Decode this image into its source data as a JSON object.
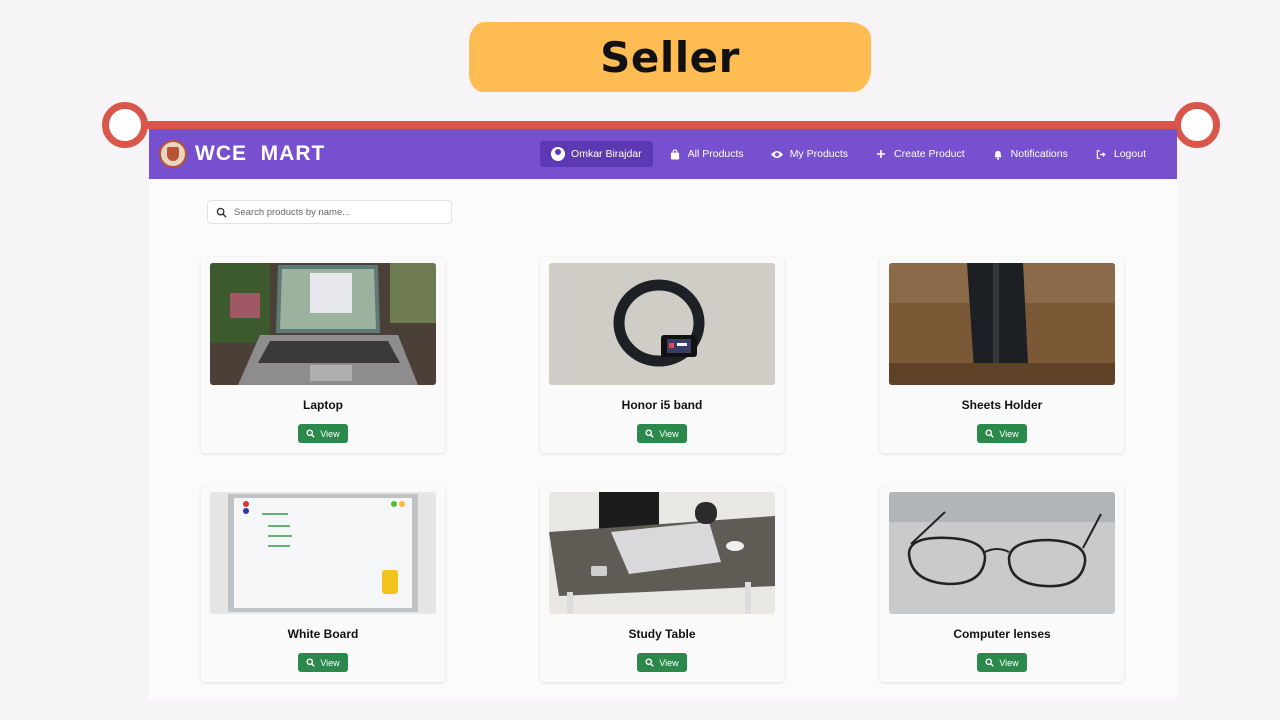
{
  "banner": {
    "text": "Seller"
  },
  "navbar": {
    "brand": "WCE  MART",
    "items": [
      {
        "label": "Omkar Birajdar",
        "icon": "user-circle-icon"
      },
      {
        "label": "All Products",
        "icon": "shopping-bag-icon"
      },
      {
        "label": "My Products",
        "icon": "eye-icon"
      },
      {
        "label": "Create Product",
        "icon": "plus-icon"
      },
      {
        "label": "Notifications",
        "icon": "bell-icon"
      },
      {
        "label": "Logout",
        "icon": "logout-icon"
      }
    ]
  },
  "search": {
    "placeholder": "Search products by name..."
  },
  "products": [
    {
      "name": "Laptop",
      "button": "View",
      "image": "laptop-photo"
    },
    {
      "name": "Honor i5 band",
      "button": "View",
      "image": "fitness-band-photo"
    },
    {
      "name": "Sheets Holder",
      "button": "View",
      "image": "sheets-holder-photo"
    },
    {
      "name": "White Board",
      "button": "View",
      "image": "whiteboard-photo"
    },
    {
      "name": "Study Table",
      "button": "View",
      "image": "study-table-photo"
    },
    {
      "name": "Computer lenses",
      "button": "View",
      "image": "glasses-photo"
    }
  ],
  "colors": {
    "navbar": "#7650cf",
    "navbar_active": "#5c39b3",
    "view_button": "#2b8a4b",
    "banner": "#ffbc52",
    "rail": "#d9574a"
  }
}
